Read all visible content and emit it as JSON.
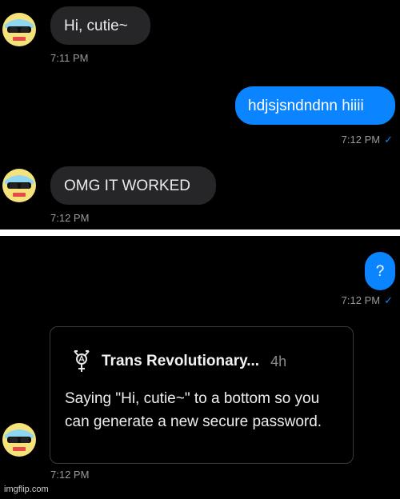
{
  "colors": {
    "incoming_bubble": "#262628",
    "outgoing_bubble": "#0a84ff",
    "divider": "#ffffff",
    "background": "#000000"
  },
  "top_panel": {
    "msg1": {
      "text": "Hi, cutie~",
      "time": "7:11 PM"
    },
    "msg2": {
      "text": "hdjsjsndndnn hiiii",
      "time": "7:12 PM",
      "status": "✓"
    },
    "msg3": {
      "text": "OMG IT WORKED",
      "time": "7:12 PM"
    }
  },
  "bottom_panel": {
    "msg4": {
      "text": "?",
      "time": "7:12 PM",
      "status": "✓"
    },
    "quote": {
      "icon": "trans-symbol-icon",
      "author": "Trans Revolutionary...",
      "age": "4h",
      "body": "Saying \"Hi, cutie~\" to a bottom so you can generate a new secure password.",
      "time": "7:12 PM"
    }
  },
  "watermark": "imgflip.com"
}
